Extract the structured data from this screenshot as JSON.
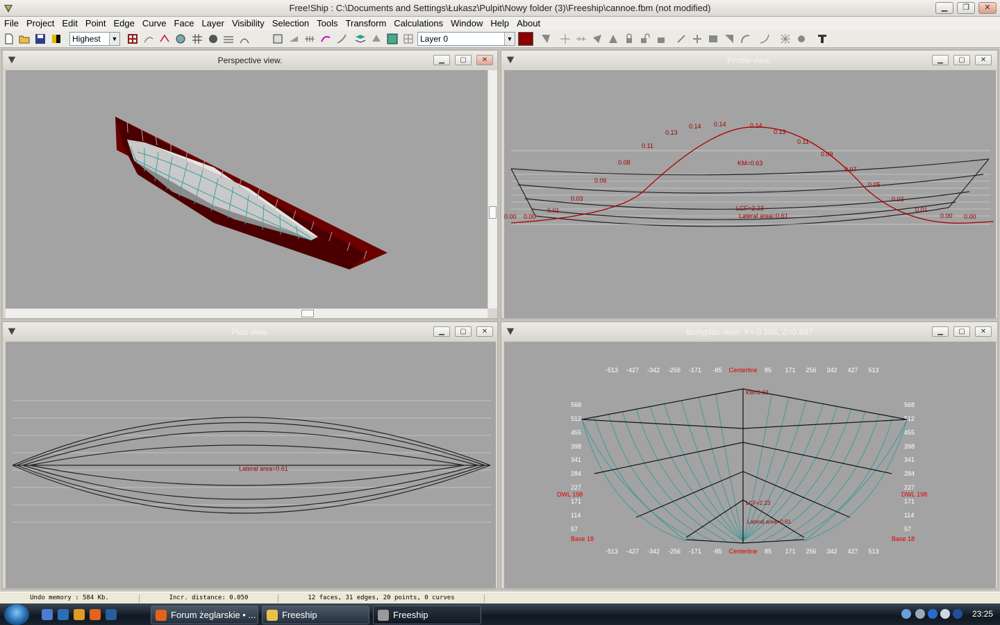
{
  "app": {
    "title": "Free!Ship  : C:\\Documents and Settings\\Łukasz\\Pulpit\\Nowy folder (3)\\Freeship\\cannoe.fbm (not modified)",
    "minimize": "▁",
    "maximize": "❐",
    "close": "✕"
  },
  "menu": [
    "File",
    "Project",
    "Edit",
    "Point",
    "Edge",
    "Curve",
    "Face",
    "Layer",
    "Visibility",
    "Selection",
    "Tools",
    "Transform",
    "Calculations",
    "Window",
    "Help",
    "About"
  ],
  "toolbar": {
    "precision": "Highest",
    "layer": "Layer 0",
    "layer_color": "#8b0000"
  },
  "windows": {
    "perspective": {
      "title": "Perspective view."
    },
    "profile": {
      "title": "Profile view.",
      "labels": [
        "0.00",
        "0.00",
        "0.01",
        "0.03",
        "0.06",
        "0.08",
        "0.11",
        "0.13",
        "0.14",
        "0.14",
        "0.14",
        "0.13",
        "0.11",
        "0.09",
        "0.07",
        "0.05",
        "0.03",
        "0.01",
        "0.00",
        "0.00"
      ],
      "km": "KM=0.63",
      "lcf": "LCF=2.23",
      "area": "Lateral area=0.61"
    },
    "plan": {
      "title": "Plan view.",
      "area": "Lateral area=0.61"
    },
    "bodyplan": {
      "title": "Bodyplan view.  Y=-0.188,  Z=0.687",
      "x_ticks": [
        "-513",
        "-427",
        "-342",
        "-256",
        "-171",
        "-85",
        "Centerline",
        "85",
        "171",
        "256",
        "342",
        "427",
        "513"
      ],
      "y_ticks": [
        "568",
        "512",
        "455",
        "398",
        "341",
        "284",
        "227",
        "171",
        "114",
        "57"
      ],
      "dwl": "DWL 198",
      "base": "Base 18",
      "km": "KM=0.63",
      "lcf": "LCF=2.23",
      "area": "Lateral area=0.61"
    }
  },
  "status": {
    "undo": "Undo memory : 584 Kb.",
    "incr": "Incr. distance: 0.050",
    "stats": "12 faces, 31 edges, 20 points, 0 curves"
  },
  "taskbar": {
    "items": [
      "Forum żeglarskie • ...",
      "Freeship",
      "Freeship"
    ],
    "clock": "23:25"
  },
  "colors": {
    "hull_red": "#7a0000",
    "curve_red": "#b00000",
    "station_cyan": "#3f9a9a",
    "view_bg": "#a3a3a3"
  }
}
